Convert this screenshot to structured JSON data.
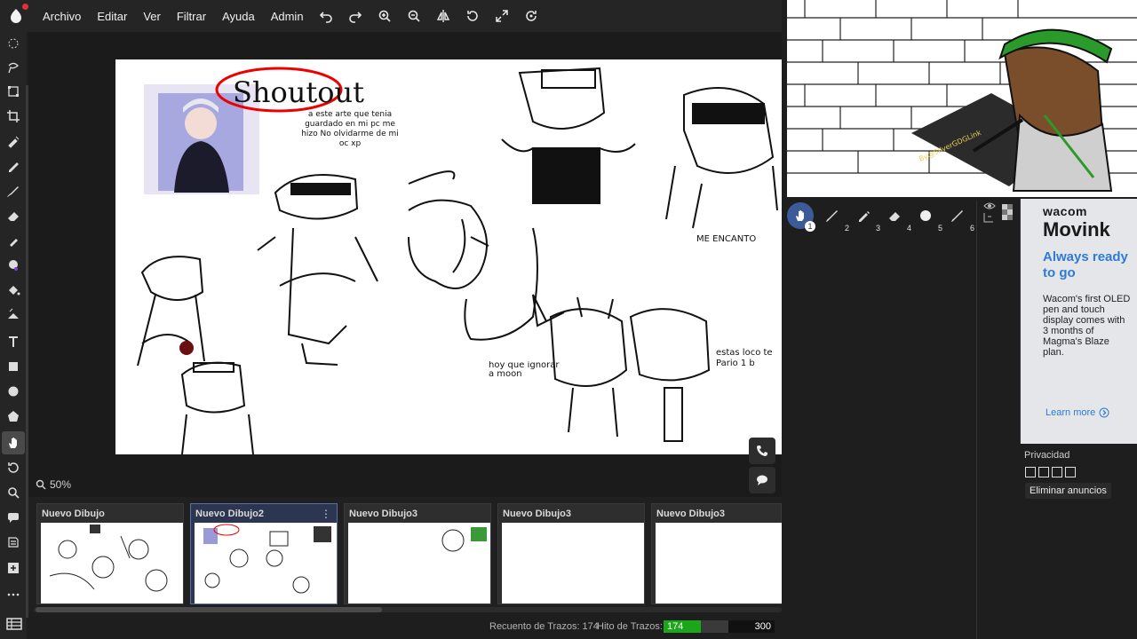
{
  "menu": {
    "items": [
      "Archivo",
      "Editar",
      "Ver",
      "Filtrar",
      "Ayuda",
      "Admin"
    ]
  },
  "toolbar_icons": [
    "undo-icon",
    "redo-icon",
    "zoom-in-icon",
    "zoom-out-icon",
    "flip-icon",
    "rotate-icon",
    "fullscreen-icon",
    "reset-view-icon"
  ],
  "left_tools": [
    "select-icon",
    "lasso-icon",
    "transform-icon",
    "crop-icon",
    "eyedropper-icon",
    "pencil-icon",
    "brush-icon",
    "eraser-icon",
    "blur-icon",
    "smudge-icon",
    "fill-icon",
    "gradient-icon",
    "text-icon",
    "rectangle-icon",
    "ellipse-icon",
    "polygon-icon",
    "hand-icon",
    "rotate-icon",
    "zoom-icon",
    "chat-icon",
    "pages-icon",
    "add-icon",
    "more-icon"
  ],
  "zoom_label": "50%",
  "canvas_text": {
    "shoutout": "Shoutout",
    "dedication": "a este arte que tenia guardado en mi pc me hizo No olvidarme de mi oc xp",
    "me_encanto": "ME ENCANTO",
    "hoy_que": "hoy que ignorar a moon",
    "estas_loco": "estas loco te Pario 1 b"
  },
  "pages": [
    {
      "title": "Nuevo Dibujo"
    },
    {
      "title": "Nuevo Dibujo2",
      "active": true
    },
    {
      "title": "Nuevo Dibujo3"
    },
    {
      "title": "Nuevo Dibujo3"
    },
    {
      "title": "Nuevo Dibujo3"
    }
  ],
  "status": {
    "stroke_count_label": "Recuento de Trazos: 174",
    "stroke_limit_label": "Hito de Trazos:",
    "stroke_value": "174",
    "stroke_max": "300",
    "stroke_progress": 0.58
  },
  "stream_tag": "By@SilverGDGLink",
  "brushes": [
    {
      "num": "1",
      "icon": "hand-icon"
    },
    {
      "num": "2",
      "icon": "brush-icon"
    },
    {
      "num": "3",
      "icon": "pen-icon"
    },
    {
      "num": "4",
      "icon": "eraser-icon"
    },
    {
      "num": "5",
      "icon": "round-brush-icon"
    },
    {
      "num": "6",
      "icon": "brush-icon"
    }
  ],
  "ad": {
    "brand": "wacom",
    "product": "Movink",
    "headline": "Always ready to go",
    "body": "Wacom's first OLED pen and touch display comes with 3 months of Magma's Blaze plan.",
    "cta": "Learn more"
  },
  "privacy": {
    "label": "Privacidad",
    "remove_ads": "Eliminar anuncios"
  },
  "colors": {
    "accent": "#3d5a99",
    "progress": "#1aa71a",
    "ad_blue": "#2e7bd6",
    "logo_dot": "#e0303a"
  }
}
